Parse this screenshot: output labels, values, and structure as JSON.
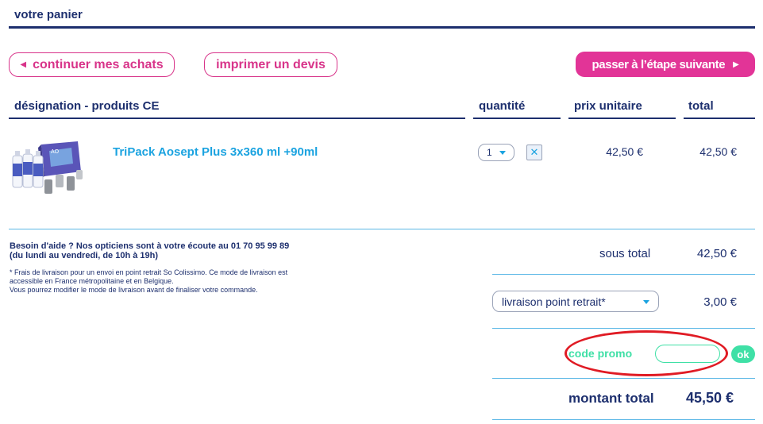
{
  "cart": {
    "title": "votre panier"
  },
  "actions": {
    "continue_label": "continuer mes achats",
    "print_quote_label": "imprimer un devis",
    "next_step_label": "passer à l’étape suivante"
  },
  "table": {
    "headers": {
      "designation": "désignation - produits CE",
      "quantity": "quantité",
      "unit_price": "prix unitaire",
      "total": "total"
    },
    "rows": [
      {
        "product_name": "TriPack Aosept Plus 3x360 ml +90ml",
        "quantity": "1",
        "unit_price": "42,50 €",
        "total": "42,50 €",
        "remove_icon": "close-icon"
      }
    ]
  },
  "help": {
    "line1": "Besoin d'aide ? Nos opticiens sont à votre écoute au 01 70 95 99 89",
    "line2": "(du lundi au vendredi, de 10h à 19h)",
    "note1": "* Frais de livraison pour un envoi en point retrait So Colissimo. Ce mode de livraison est",
    "note2": "accessible en France métropolitaine et en Belgique.",
    "note3": "Vous pourrez modifier le mode de livraison avant de finaliser votre commande."
  },
  "summary": {
    "subtotal_label": "sous total",
    "subtotal_value": "42,50 €",
    "delivery_option": "livraison point retrait*",
    "delivery_value": "3,00 €",
    "promo_label": "code promo",
    "promo_value": "",
    "promo_ok_label": "ok",
    "total_label": "montant total",
    "total_value": "45,50 €"
  },
  "colors": {
    "navy": "#1d2f6e",
    "magenta": "#d8348a",
    "link_blue": "#1ba3e0",
    "promo_green": "#3fe0a6",
    "highlight_red": "#e01b24"
  }
}
